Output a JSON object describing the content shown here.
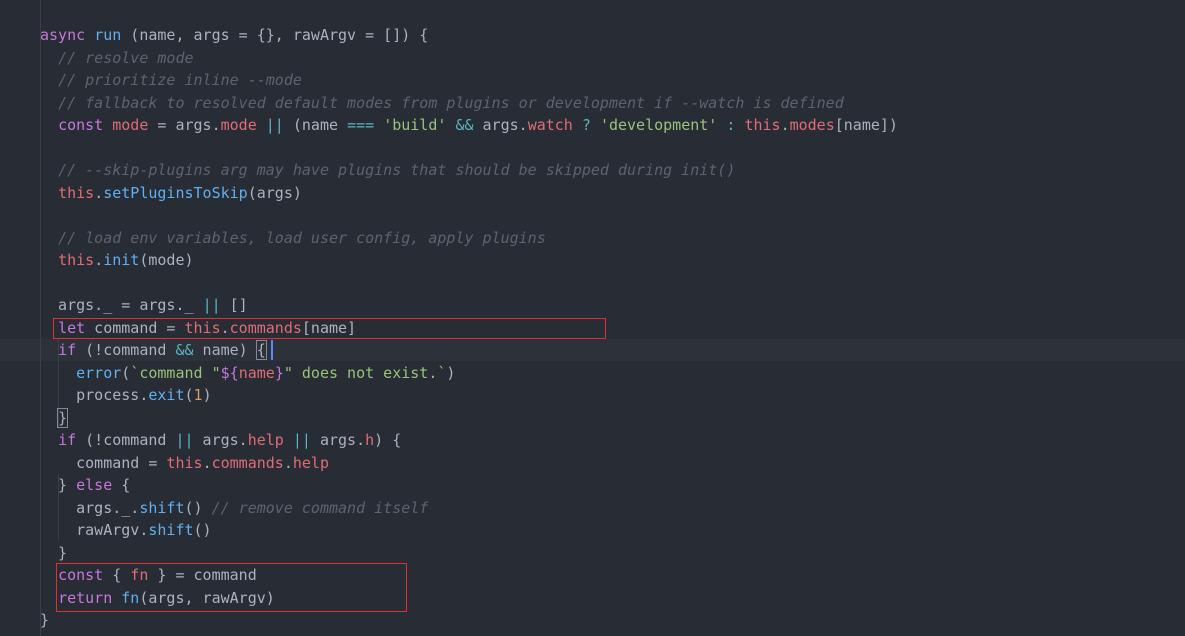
{
  "code": {
    "lines": [
      [
        {
          "t": "async",
          "c": "kw"
        },
        {
          "t": " ",
          "c": "plain"
        },
        {
          "t": "run",
          "c": "fn"
        },
        {
          "t": " (name, args = {}, rawArgv = []) {",
          "c": "plain"
        }
      ],
      [
        {
          "t": "  ",
          "c": "plain"
        },
        {
          "t": "// resolve mode",
          "c": "cmt"
        }
      ],
      [
        {
          "t": "  ",
          "c": "plain"
        },
        {
          "t": "// prioritize inline --mode",
          "c": "cmt"
        }
      ],
      [
        {
          "t": "  ",
          "c": "plain"
        },
        {
          "t": "// fallback to resolved default modes from plugins or development if --watch is defined",
          "c": "cmt"
        }
      ],
      [
        {
          "t": "  ",
          "c": "plain"
        },
        {
          "t": "const",
          "c": "kw"
        },
        {
          "t": " ",
          "c": "plain"
        },
        {
          "t": "mode",
          "c": "prop"
        },
        {
          "t": " = args.",
          "c": "plain"
        },
        {
          "t": "mode",
          "c": "prop"
        },
        {
          "t": " ",
          "c": "plain"
        },
        {
          "t": "||",
          "c": "op"
        },
        {
          "t": " (name ",
          "c": "plain"
        },
        {
          "t": "===",
          "c": "op"
        },
        {
          "t": " ",
          "c": "plain"
        },
        {
          "t": "'build'",
          "c": "str"
        },
        {
          "t": " ",
          "c": "plain"
        },
        {
          "t": "&&",
          "c": "op"
        },
        {
          "t": " args.",
          "c": "plain"
        },
        {
          "t": "watch",
          "c": "prop"
        },
        {
          "t": " ",
          "c": "plain"
        },
        {
          "t": "?",
          "c": "op"
        },
        {
          "t": " ",
          "c": "plain"
        },
        {
          "t": "'development'",
          "c": "str"
        },
        {
          "t": " ",
          "c": "plain"
        },
        {
          "t": ":",
          "c": "op"
        },
        {
          "t": " ",
          "c": "plain"
        },
        {
          "t": "this",
          "c": "this"
        },
        {
          "t": ".",
          "c": "plain"
        },
        {
          "t": "modes",
          "c": "prop"
        },
        {
          "t": "[name])",
          "c": "plain"
        }
      ],
      [],
      [
        {
          "t": "  ",
          "c": "plain"
        },
        {
          "t": "// --skip-plugins arg may have plugins that should be skipped during init()",
          "c": "cmt"
        }
      ],
      [
        {
          "t": "  ",
          "c": "plain"
        },
        {
          "t": "this",
          "c": "this"
        },
        {
          "t": ".",
          "c": "plain"
        },
        {
          "t": "setPluginsToSkip",
          "c": "fn"
        },
        {
          "t": "(args)",
          "c": "plain"
        }
      ],
      [],
      [
        {
          "t": "  ",
          "c": "plain"
        },
        {
          "t": "// load env variables, load user config, apply plugins",
          "c": "cmt"
        }
      ],
      [
        {
          "t": "  ",
          "c": "plain"
        },
        {
          "t": "this",
          "c": "this"
        },
        {
          "t": ".",
          "c": "plain"
        },
        {
          "t": "init",
          "c": "fn"
        },
        {
          "t": "(mode)",
          "c": "plain"
        }
      ],
      [],
      [
        {
          "t": "  args._ = args._ ",
          "c": "plain"
        },
        {
          "t": "||",
          "c": "op"
        },
        {
          "t": " []",
          "c": "plain"
        }
      ],
      [
        {
          "t": "  ",
          "c": "plain"
        },
        {
          "t": "let",
          "c": "kw"
        },
        {
          "t": " command = ",
          "c": "plain"
        },
        {
          "t": "this",
          "c": "this"
        },
        {
          "t": ".",
          "c": "plain"
        },
        {
          "t": "commands",
          "c": "prop"
        },
        {
          "t": "[name]",
          "c": "plain"
        }
      ],
      [
        {
          "t": "  ",
          "c": "plain"
        },
        {
          "t": "if",
          "c": "kw"
        },
        {
          "t": " (!command ",
          "c": "plain"
        },
        {
          "t": "&&",
          "c": "op"
        },
        {
          "t": " name) ",
          "c": "plain"
        },
        {
          "t": "{",
          "c": "plain",
          "m": 1
        }
      ],
      [
        {
          "t": "    ",
          "c": "plain"
        },
        {
          "t": "error",
          "c": "fn"
        },
        {
          "t": "(",
          "c": "plain"
        },
        {
          "t": "`command \"",
          "c": "str"
        },
        {
          "t": "${",
          "c": "interp"
        },
        {
          "t": "name",
          "c": "ivar"
        },
        {
          "t": "}",
          "c": "interp"
        },
        {
          "t": "\" does not exist.`",
          "c": "str"
        },
        {
          "t": ")",
          "c": "plain"
        }
      ],
      [
        {
          "t": "    process.",
          "c": "plain"
        },
        {
          "t": "exit",
          "c": "fn"
        },
        {
          "t": "(",
          "c": "plain"
        },
        {
          "t": "1",
          "c": "num"
        },
        {
          "t": ")",
          "c": "plain"
        }
      ],
      [
        {
          "t": "  ",
          "c": "plain"
        },
        {
          "t": "}",
          "c": "plain",
          "m": 1
        }
      ],
      [
        {
          "t": "  ",
          "c": "plain"
        },
        {
          "t": "if",
          "c": "kw"
        },
        {
          "t": " (!command ",
          "c": "plain"
        },
        {
          "t": "||",
          "c": "op"
        },
        {
          "t": " args.",
          "c": "plain"
        },
        {
          "t": "help",
          "c": "prop"
        },
        {
          "t": " ",
          "c": "plain"
        },
        {
          "t": "||",
          "c": "op"
        },
        {
          "t": " args.",
          "c": "plain"
        },
        {
          "t": "h",
          "c": "prop"
        },
        {
          "t": ") {",
          "c": "plain"
        }
      ],
      [
        {
          "t": "    command = ",
          "c": "plain"
        },
        {
          "t": "this",
          "c": "this"
        },
        {
          "t": ".",
          "c": "plain"
        },
        {
          "t": "commands",
          "c": "prop"
        },
        {
          "t": ".",
          "c": "plain"
        },
        {
          "t": "help",
          "c": "prop"
        }
      ],
      [
        {
          "t": "  } ",
          "c": "plain"
        },
        {
          "t": "else",
          "c": "kw"
        },
        {
          "t": " {",
          "c": "plain"
        }
      ],
      [
        {
          "t": "    args._.",
          "c": "plain"
        },
        {
          "t": "shift",
          "c": "fn"
        },
        {
          "t": "() ",
          "c": "plain"
        },
        {
          "t": "// remove command itself",
          "c": "cmt"
        }
      ],
      [
        {
          "t": "    rawArgv.",
          "c": "plain"
        },
        {
          "t": "shift",
          "c": "fn"
        },
        {
          "t": "()",
          "c": "plain"
        }
      ],
      [
        {
          "t": "  }",
          "c": "plain"
        }
      ],
      [
        {
          "t": "  ",
          "c": "plain"
        },
        {
          "t": "const",
          "c": "kw"
        },
        {
          "t": " { ",
          "c": "plain"
        },
        {
          "t": "fn",
          "c": "prop"
        },
        {
          "t": " } = command",
          "c": "plain"
        }
      ],
      [
        {
          "t": "  ",
          "c": "plain"
        },
        {
          "t": "return",
          "c": "kw"
        },
        {
          "t": " ",
          "c": "plain"
        },
        {
          "t": "fn",
          "c": "fn"
        },
        {
          "t": "(args, rawArgv)",
          "c": "plain"
        }
      ],
      [
        {
          "t": "}",
          "c": "plain"
        }
      ]
    ],
    "current_line_index": 14,
    "highlighted_line_ranges": [
      [
        13,
        13
      ],
      [
        24,
        25
      ]
    ]
  },
  "colors": {
    "background": "#282c34",
    "current_line": "#2c313a",
    "highlight_box": "#e03131",
    "cursor": "#528bff"
  }
}
